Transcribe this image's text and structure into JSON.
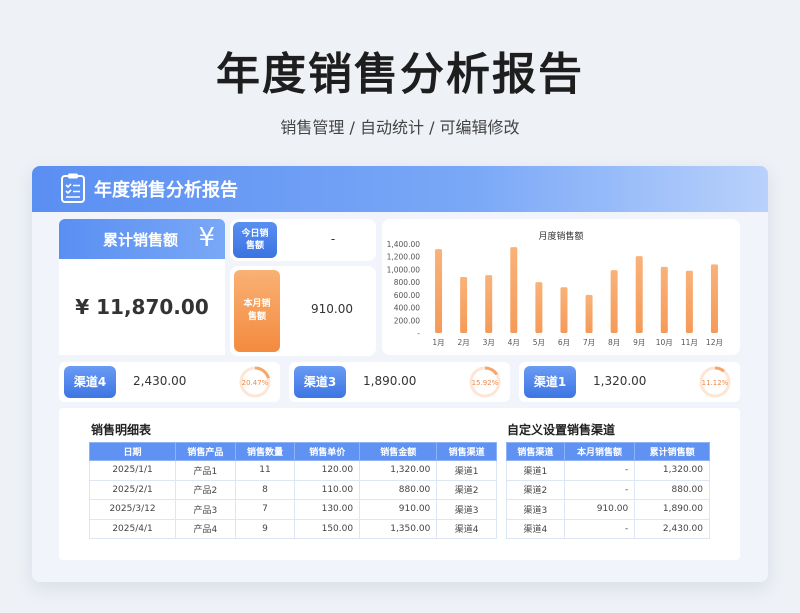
{
  "hero": {
    "title": "年度销售分析报告",
    "subtitle": "销售管理 / 自动统计 /  可编辑修改"
  },
  "card": {
    "title": "年度销售分析报告",
    "icon": "document-checklist-icon"
  },
  "cumulative": {
    "label": "累计销售额",
    "icon": "¥",
    "value": "¥ 11,870.00"
  },
  "today": {
    "label_line1": "今日销",
    "label_line2": "售额",
    "value": "-"
  },
  "month": {
    "label_line1": "本月销",
    "label_line2": "售额",
    "value": "910.00"
  },
  "chart_data": {
    "type": "bar",
    "title": "月度销售额",
    "categories": [
      "1月",
      "2月",
      "3月",
      "4月",
      "5月",
      "6月",
      "7月",
      "8月",
      "9月",
      "10月",
      "11月",
      "12月"
    ],
    "values": [
      1320,
      880,
      910,
      1350,
      800,
      720,
      600,
      990,
      1210,
      1040,
      980,
      1080
    ],
    "ylim": [
      0,
      1400
    ],
    "yticks": [
      "1,400.00",
      "1,200.00",
      "1,000.00",
      "800.00",
      "600.00",
      "400.00",
      "200.00",
      "-"
    ],
    "ytick_values": [
      1400,
      1200,
      1000,
      800,
      600,
      400,
      200,
      0
    ],
    "bar_color_top": "#f9b27a",
    "bar_color_bottom": "#f59a58",
    "grid": false
  },
  "channels": [
    {
      "name": "渠道4",
      "value": "2,430.00",
      "percent": "20.47%",
      "fraction": 0.2047
    },
    {
      "name": "渠道3",
      "value": "1,890.00",
      "percent": "15.92%",
      "fraction": 0.1592
    },
    {
      "name": "渠道1",
      "value": "1,320.00",
      "percent": "11.12%",
      "fraction": 0.1112
    }
  ],
  "detail_table": {
    "title": "销售明细表",
    "headers": [
      "日期",
      "销售产品",
      "销售数量",
      "销售单价",
      "销售金额",
      "销售渠道"
    ],
    "rows": [
      [
        "2025/1/1",
        "产品1",
        "11",
        "120.00",
        "1,320.00",
        "渠道1"
      ],
      [
        "2025/2/1",
        "产品2",
        "8",
        "110.00",
        "880.00",
        "渠道2"
      ],
      [
        "2025/3/12",
        "产品3",
        "7",
        "130.00",
        "910.00",
        "渠道3"
      ],
      [
        "2025/4/1",
        "产品4",
        "9",
        "150.00",
        "1,350.00",
        "渠道4"
      ]
    ]
  },
  "channel_table": {
    "title": "自定义设置销售渠道",
    "headers": [
      "销售渠道",
      "本月销售额",
      "累计销售额"
    ],
    "rows": [
      [
        "渠道1",
        "-",
        "1,320.00"
      ],
      [
        "渠道2",
        "-",
        "880.00"
      ],
      [
        "渠道3",
        "910.00",
        "1,890.00"
      ],
      [
        "渠道4",
        "-",
        "2,430.00"
      ]
    ]
  },
  "colors": {
    "accent_blue": "#5a8ff2",
    "accent_orange": "#f59a58",
    "ring_track": "#fde6d6",
    "ring_fill": "#f5a66a"
  }
}
